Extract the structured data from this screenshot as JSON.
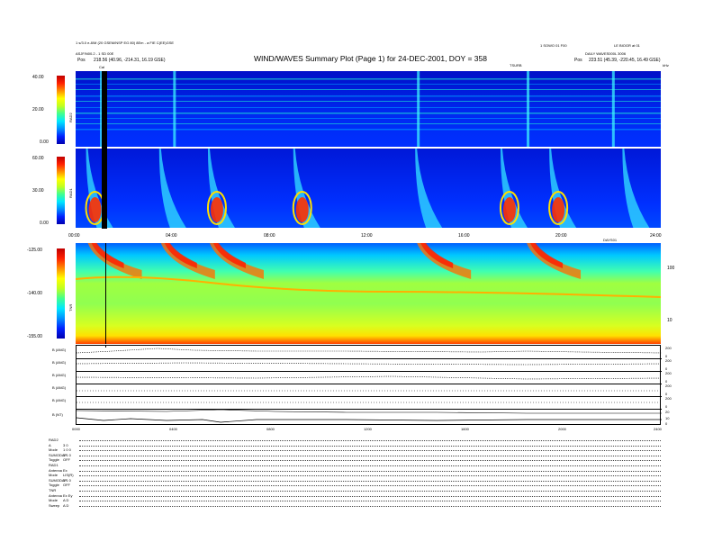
{
  "header": {
    "title": "WIND/WAVES Summary Plot (Page 1) for 24-DEC-2001, DOY = 358",
    "left_line1": "1 s/3.0 e-8/M (20 GSEM/NSP EG 80) 8Em - a FIE C(EE)GSE",
    "left_line2": "ASJF/N00.2 - 1 SD 00E",
    "left_pos_label": "Pos",
    "left_pos_value": "218.56 (40.96, -214.31, 16.19 GSE)",
    "right_line1": "1 SOWO 01 F00",
    "right_line2": "LE BIOGR at 01",
    "right_line3": "DAILY WAVES000L 3006",
    "right_pos_label": "Pos",
    "right_pos_value": "223.51 (45.39, -220.45, 16.49 GSE)",
    "right_label_mid": "TSURB",
    "right_label_far": "kHz",
    "cal_label": "Cal"
  },
  "rad2": {
    "ylabel": "RAD2",
    "ticks": [
      "40.00",
      "20.00",
      "0.00"
    ]
  },
  "rad1": {
    "ylabel": "RAD1",
    "ticks": [
      "60.00",
      "30.00",
      "0.00"
    ]
  },
  "time_axis_mid": {
    "labels": [
      "00:00",
      "04:00",
      "08:00",
      "12:00",
      "16:00",
      "20:00",
      "24:00"
    ],
    "extra": "DAYS01"
  },
  "tnr": {
    "ylabel": "TNR",
    "ticks": [
      "-125.00",
      "-140.00",
      "-155.00"
    ],
    "right_ticks": [
      "100",
      "10"
    ]
  },
  "timeseries": {
    "labels": [
      "B (ANG)",
      "B (ANG)",
      "B (ANG)",
      "B (ANG)",
      "B (ANG)",
      "B (NT)"
    ],
    "right_ticks": [
      [
        "200",
        "0"
      ],
      [
        "200",
        "0"
      ],
      [
        "200",
        "0"
      ],
      [
        "200",
        "0"
      ],
      [
        "200",
        "0"
      ],
      [
        "20",
        "10",
        "0"
      ]
    ]
  },
  "time_axis_bottom": {
    "labels": [
      "0000",
      "0400",
      "0800",
      "1200",
      "1600",
      "2000",
      "2400"
    ]
  },
  "modes": [
    {
      "key": "RAD2",
      "val": ""
    },
    {
      "key": "A",
      "val": "3 0"
    },
    {
      "key": "Mode",
      "val": "1 0 0"
    },
    {
      "key": "SUMODAP",
      "val": "1 1 0"
    },
    {
      "key": "Toggle",
      "val": "OFF"
    },
    {
      "key": "RAD1",
      "val": ""
    },
    {
      "key": "Antenna",
      "val": "Ex"
    },
    {
      "key": "Mode",
      "val": "LIS(R)"
    },
    {
      "key": "SUMODAP",
      "val": "1 1 0"
    },
    {
      "key": "Toggle",
      "val": "OFF"
    },
    {
      "key": "TNR",
      "val": ""
    },
    {
      "key": "Antenna",
      "val": "Ex Ey"
    },
    {
      "key": "Mode",
      "val": "A D"
    },
    {
      "key": "Sweep",
      "val": "A D"
    }
  ],
  "colors": {
    "spectral": [
      "#0000b0",
      "#0020ff",
      "#0090ff",
      "#00e8ff",
      "#40ff90",
      "#c0ff20",
      "#ffff00",
      "#ff9000",
      "#ff2000",
      "#c00000"
    ]
  },
  "chart_data": {
    "type": "heatmap",
    "title": "WIND/WAVES Summary Plot (Page 1) for 24-DEC-2001, DOY = 358",
    "x_range": [
      "00:00",
      "24:00"
    ],
    "panels": [
      {
        "name": "RAD2",
        "ylim": [
          0,
          40
        ],
        "burst_hours": [
          1.0,
          4.0,
          14.0,
          18.5,
          22.0
        ]
      },
      {
        "name": "RAD1",
        "ylim": [
          0,
          60
        ],
        "burst_hours": [
          0.5,
          3.5,
          5.5,
          9.0,
          14.0,
          17.5,
          19.5,
          22.5
        ]
      },
      {
        "name": "TNR",
        "ylim": [
          -155,
          -125
        ],
        "burst_hours": [
          0.5,
          3.5,
          5.5,
          14.0,
          18.5
        ]
      }
    ]
  }
}
